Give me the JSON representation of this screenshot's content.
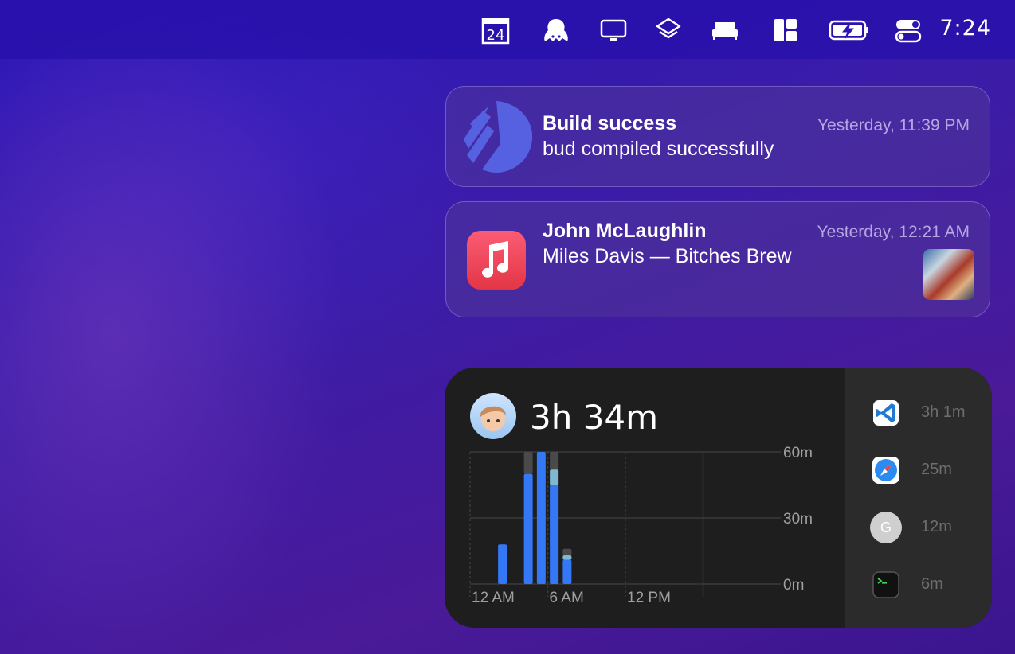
{
  "menubar": {
    "calendar_day": "24",
    "clock": "7:24",
    "icons": [
      "calendar-icon",
      "octopus-icon",
      "display-icon",
      "layers-icon",
      "bed-icon",
      "layout-icon",
      "battery-charging-icon",
      "control-center-icon"
    ]
  },
  "notifications": [
    {
      "title": "Build success",
      "body": "bud compiled successfully",
      "time": "Yesterday, 11:39 PM",
      "app_icon": "bud-logo-icon"
    },
    {
      "title": "John McLaughlin",
      "body": "Miles Davis — Bitches Brew",
      "time": "Yesterday, 12:21 AM",
      "app_icon": "music-icon"
    }
  ],
  "screen_time": {
    "total": "3h 34m",
    "apps": [
      {
        "icon": "vscode-icon",
        "time": "3h 1m"
      },
      {
        "icon": "safari-icon",
        "time": "25m"
      },
      {
        "icon": "g-icon",
        "letter": "G",
        "time": "12m"
      },
      {
        "icon": "terminal-icon",
        "time": "6m"
      }
    ]
  },
  "chart_data": {
    "type": "bar",
    "x_ticks": [
      "12 AM",
      "6 AM",
      "12 PM"
    ],
    "y_ticks": [
      "60m",
      "30m",
      "0m"
    ],
    "ylim": [
      0,
      60
    ],
    "series_colors": {
      "main": "#3478f6",
      "secondary": "#7fb8d0",
      "other": "#4a4a4a"
    },
    "bars": [
      {
        "hour": 2.5,
        "main": 18,
        "secondary": 0,
        "other": 0
      },
      {
        "hour": 4.5,
        "main": 50,
        "secondary": 0,
        "other": 10
      },
      {
        "hour": 5.5,
        "main": 60,
        "secondary": 0,
        "other": 0
      },
      {
        "hour": 6.5,
        "main": 45,
        "secondary": 7,
        "other": 8
      },
      {
        "hour": 7.5,
        "main": 11,
        "secondary": 2,
        "other": 3
      }
    ]
  }
}
